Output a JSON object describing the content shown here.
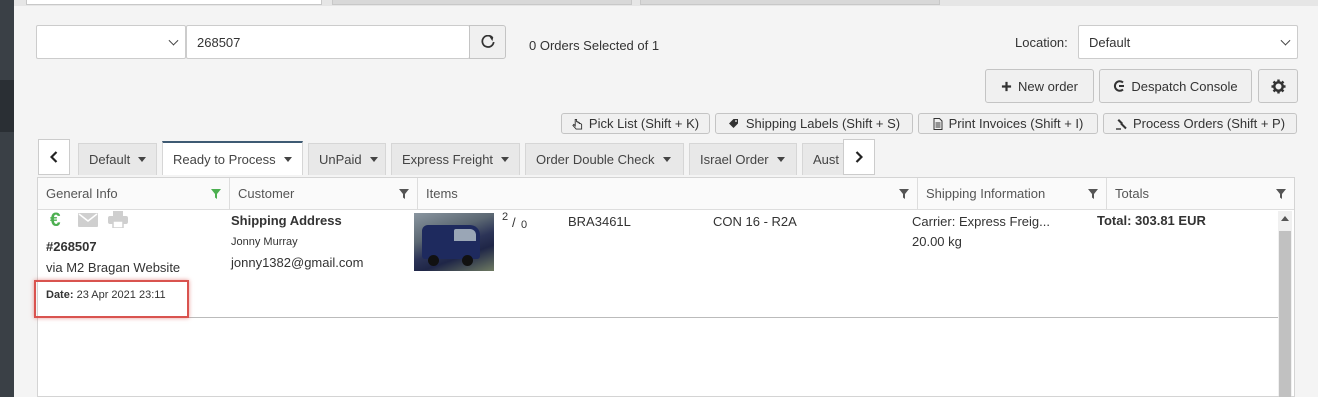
{
  "toolbar": {
    "search_value": "268507",
    "orders_selected": "0 Orders Selected of 1",
    "location_label": "Location:",
    "location_value": "Default",
    "new_order": "New order",
    "despatch_console": "Despatch Console"
  },
  "actions": {
    "pick_list": "Pick List (Shift + K)",
    "shipping_labels": "Shipping Labels (Shift + S)",
    "print_invoices": "Print Invoices (Shift + I)",
    "process_orders": "Process Orders (Shift + P)"
  },
  "view_tabs": [
    "Default",
    "Ready to Process",
    "UnPaid",
    "Express Freight",
    "Order Double Check",
    "Israel Order",
    "Aust"
  ],
  "columns": {
    "general_info": "General Info",
    "customer": "Customer",
    "items": "Items",
    "shipping_information": "Shipping Information",
    "totals": "Totals"
  },
  "order": {
    "number": "#268507",
    "source": "via M2 Bragan Website",
    "date_label": "Date:",
    "date_value": "23 Apr 2021 23:11",
    "customer_heading": "Shipping Address",
    "customer_name": "Jonny Murray",
    "customer_email": "jonny1382@gmail.com",
    "qty_sup": "2",
    "qty_sep": "/",
    "qty_sub": "0",
    "sku": "BRA3461L",
    "item_title": "CON 16 - R2A",
    "carrier": "Carrier: Express Freig...",
    "weight": "20.00 kg",
    "total": "Total: 303.81 EUR"
  },
  "colors": {
    "paid_icon": "#4caf50",
    "highlight": "#d9534f",
    "active_tab": "#3e5a73",
    "filter_active": "#4caf50"
  }
}
